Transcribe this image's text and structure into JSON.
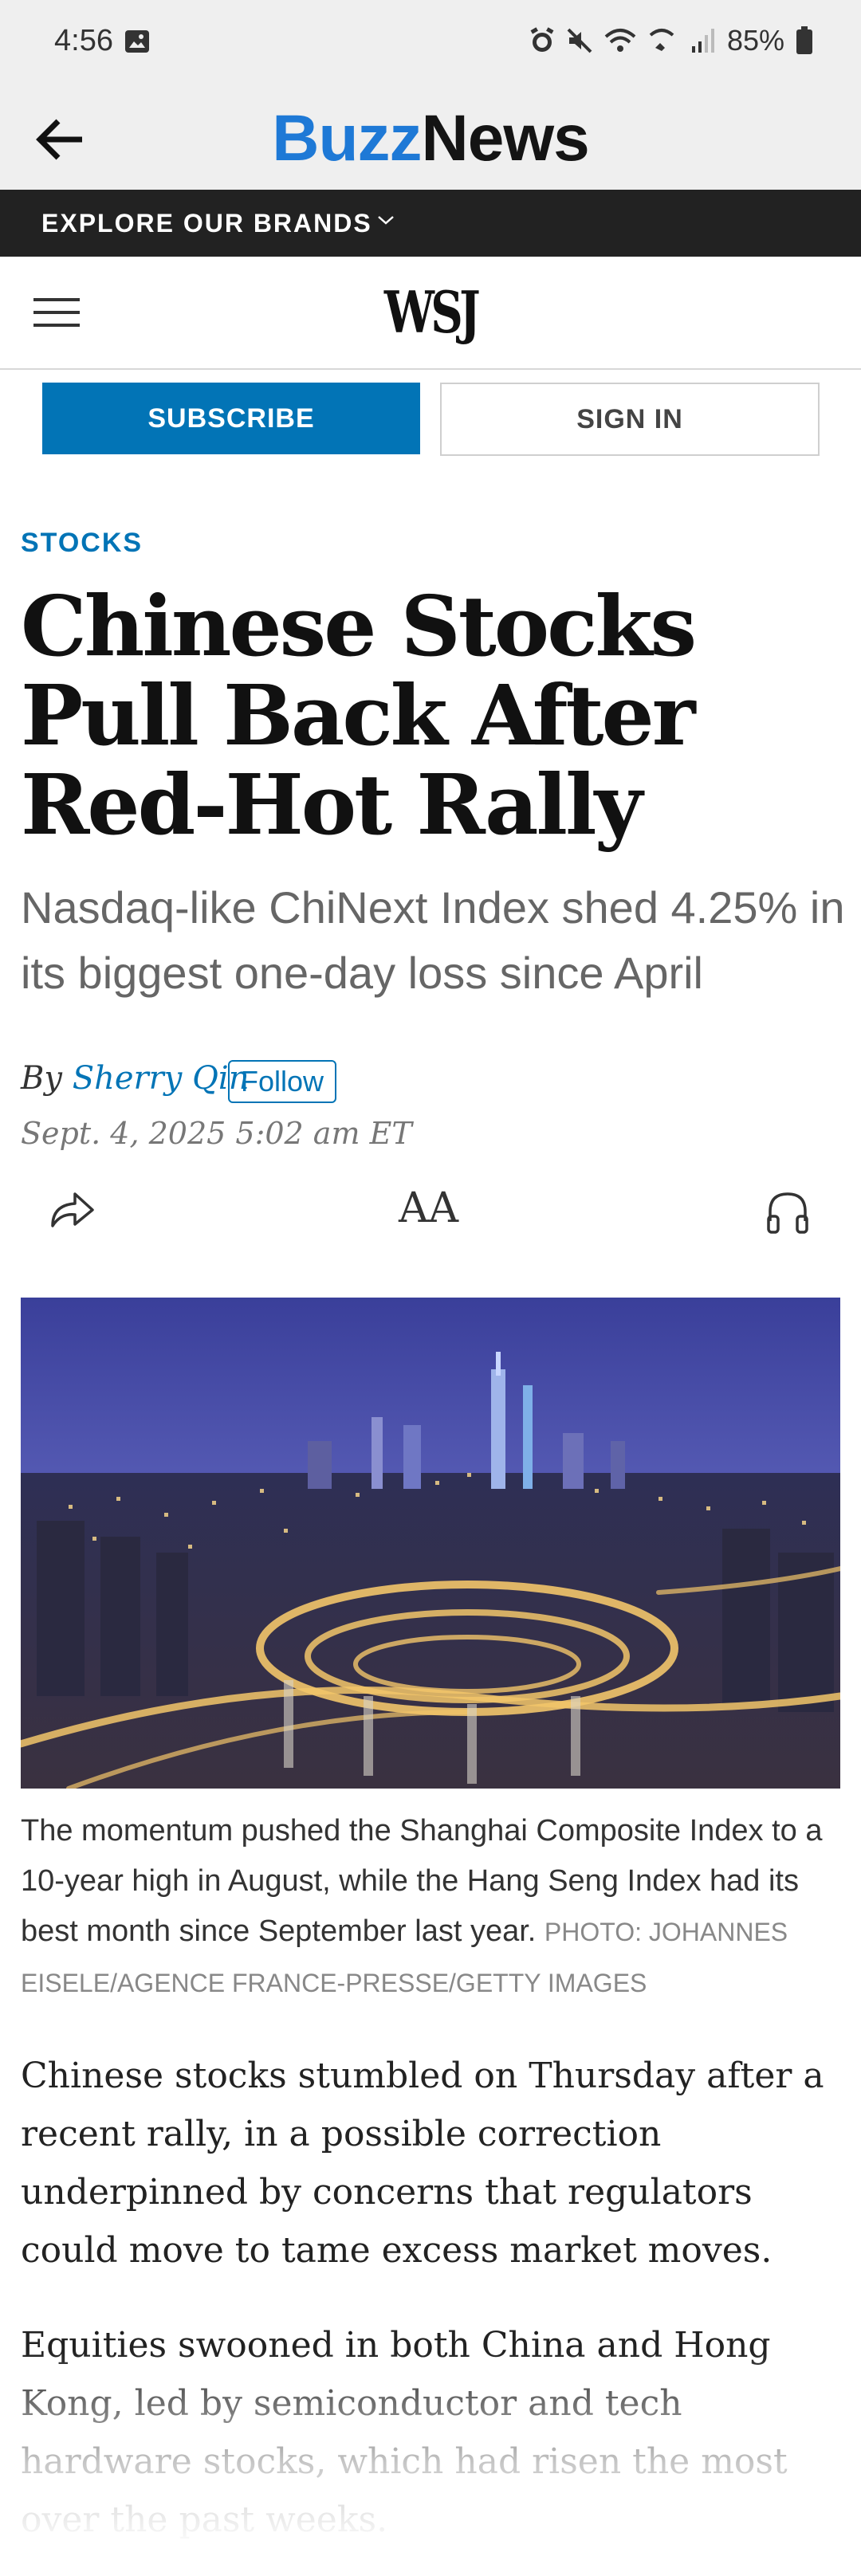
{
  "status_bar": {
    "time": "4:56",
    "battery": "85%"
  },
  "app_bar": {
    "title_part1": "Buzz",
    "title_part2": "News"
  },
  "brands_bar": {
    "label": "EXPLORE OUR BRANDS"
  },
  "wsj_header": {
    "logo": "WSJ"
  },
  "auth": {
    "subscribe": "SUBSCRIBE",
    "sign_in": "SIGN IN"
  },
  "article": {
    "section": "STOCKS",
    "headline": "Chinese Stocks Pull Back After Red-Hot Rally",
    "dek": "Nasdaq-like ChiNext Index shed 4.25% in its biggest one-day loss since April",
    "byline_prefix": "By",
    "author": "Sherry Qin",
    "follow": "Follow",
    "date": "Sept. 4, 2025 5:02 am ET",
    "text_size_glyph": "AA",
    "caption": "The momentum pushed the Shanghai Composite Index to a 10-year high in August, while the Hang Seng Index had its best month since September last year.",
    "photo_credit": "PHOTO: JOHANNES EISELE/AGENCE FRANCE-PRESSE/GETTY IMAGES",
    "paragraphs": [
      "Chinese stocks stumbled on Thursday after a recent rally, in a possible correction underpinned by concerns that regulators could move to tame excess market moves.",
      "Equities swooned in both China and Hong Kong, led by semiconductor and tech hardware stocks, which had risen the most over the past weeks."
    ]
  },
  "colors": {
    "accent_blue": "#0274b6",
    "buzz_blue": "#1e79d6",
    "brands_bar_bg": "#222222"
  },
  "icons": [
    "image-icon",
    "alarm-icon",
    "mute-icon",
    "wifi-icon",
    "wifi-calling-icon",
    "signal-icon",
    "battery-icon",
    "back-arrow-icon",
    "chevron-down-icon",
    "menu-icon",
    "share-icon",
    "text-size-icon",
    "headphones-icon"
  ]
}
